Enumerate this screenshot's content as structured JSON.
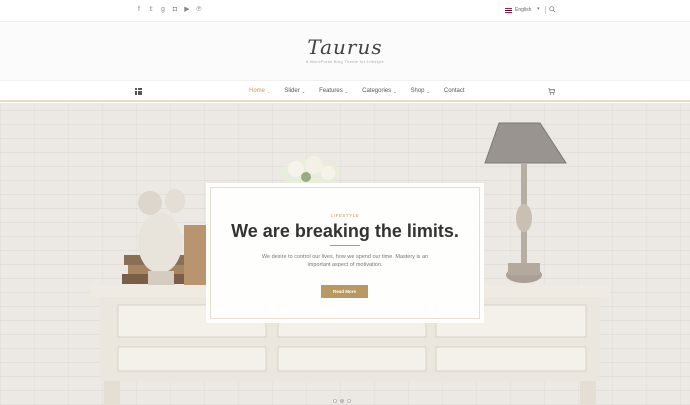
{
  "social_icons": [
    "facebook-icon",
    "twitter-icon",
    "google-plus-icon",
    "instagram-icon",
    "youtube-icon",
    "pinterest-icon"
  ],
  "language": {
    "label": "English",
    "flag": "uk-flag-icon"
  },
  "header": {
    "logo": "Taurus",
    "tagline": "A WordPress Blog Theme for Lifestyle"
  },
  "nav": {
    "items": [
      {
        "label": "Home",
        "has_dropdown": true,
        "active": true
      },
      {
        "label": "Slider",
        "has_dropdown": true,
        "active": false
      },
      {
        "label": "Features",
        "has_dropdown": true,
        "active": false
      },
      {
        "label": "Categories",
        "has_dropdown": true,
        "active": false
      },
      {
        "label": "Shop",
        "has_dropdown": true,
        "active": false
      },
      {
        "label": "Contact",
        "has_dropdown": false,
        "active": false
      }
    ],
    "caret": "⌄"
  },
  "hero": {
    "category": "LIFESTYLE",
    "headline": "We are breaking the limits.",
    "description": "We desire to control our lives, how we spend our time. Mastery is an important aspect of motivation.",
    "button": "Read More",
    "slides": 3,
    "active_slide": 2
  },
  "colors": {
    "accent": "#c49a5c",
    "button": "#b99864",
    "text": "#333333"
  }
}
